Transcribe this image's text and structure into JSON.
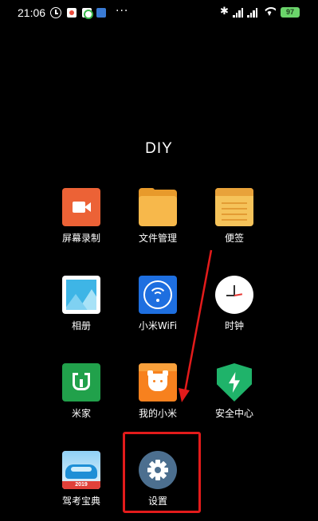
{
  "status_bar": {
    "time": "21:06",
    "battery": "97",
    "icons": [
      "alarm-icon",
      "app-notification-icon",
      "app-notification-icon",
      "app-notification-icon",
      "more-icon",
      "bluetooth-icon",
      "signal-icon",
      "signal-icon",
      "wifi-icon",
      "battery-icon"
    ],
    "more": "···"
  },
  "folder": {
    "title": "DIY"
  },
  "apps": [
    {
      "label": "屏幕录制",
      "icon": "screen-recorder-icon",
      "color": "#ec6236"
    },
    {
      "label": "文件管理",
      "icon": "folder-icon",
      "color": "#f7b84b"
    },
    {
      "label": "便签",
      "icon": "notes-icon",
      "color": "#f5c35a"
    },
    {
      "label": "相册",
      "icon": "gallery-icon",
      "color": "#3eb5e6"
    },
    {
      "label": "小米WiFi",
      "icon": "wifi-icon",
      "color": "#1e6fe0"
    },
    {
      "label": "时钟",
      "icon": "clock-icon",
      "color": "#ffffff"
    },
    {
      "label": "米家",
      "icon": "mijia-icon",
      "color": "#21a14b"
    },
    {
      "label": "我的小米",
      "icon": "my-xiaomi-icon",
      "color": "#f7811e"
    },
    {
      "label": "安全中心",
      "icon": "security-shield-icon",
      "color": "#1fb36a"
    },
    {
      "label": "驾考宝典",
      "icon": "driving-test-icon",
      "color": "#1e8fd6"
    },
    {
      "label": "设置",
      "icon": "settings-gear-icon",
      "color": "#4c6f8f"
    }
  ],
  "drive_icon_year": "2019",
  "annotation": {
    "highlight_color": "#e31b1b"
  }
}
